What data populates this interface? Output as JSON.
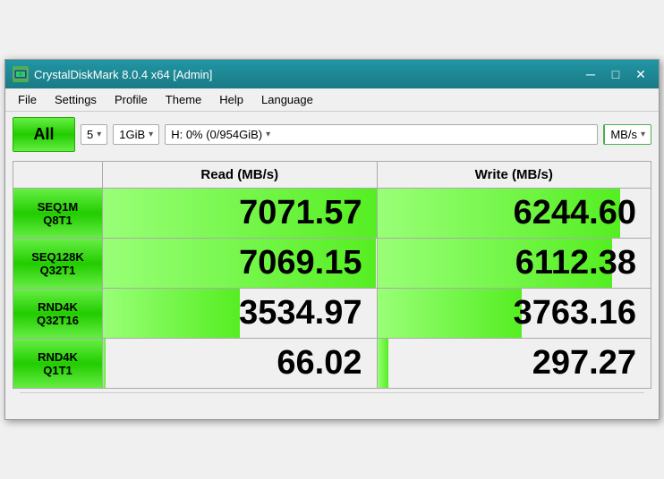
{
  "titlebar": {
    "title": "CrystalDiskMark 8.0.4 x64 [Admin]",
    "icon_label": "C",
    "minimize_label": "─",
    "maximize_label": "□",
    "close_label": "✕"
  },
  "menubar": {
    "items": [
      {
        "label": "File"
      },
      {
        "label": "Settings"
      },
      {
        "label": "Profile"
      },
      {
        "label": "Theme"
      },
      {
        "label": "Help"
      },
      {
        "label": "Language"
      }
    ]
  },
  "toolbar": {
    "all_button": "All",
    "runs_value": "5",
    "size_value": "1GiB",
    "drive_value": "H: 0% (0/954GiB)",
    "unit_value": "MB/s"
  },
  "table": {
    "col_read": "Read (MB/s)",
    "col_write": "Write (MB/s)",
    "rows": [
      {
        "label_line1": "SEQ1M",
        "label_line2": "Q8T1",
        "read": "7071.57",
        "write": "6244.60",
        "read_pct": 100,
        "write_pct": 89
      },
      {
        "label_line1": "SEQ128K",
        "label_line2": "Q32T1",
        "read": "7069.15",
        "write": "6112.38",
        "read_pct": 99.9,
        "write_pct": 86
      },
      {
        "label_line1": "RND4K",
        "label_line2": "Q32T16",
        "read": "3534.97",
        "write": "3763.16",
        "read_pct": 50,
        "write_pct": 53
      },
      {
        "label_line1": "RND4K",
        "label_line2": "Q1T1",
        "read": "66.02",
        "write": "297.27",
        "read_pct": 1,
        "write_pct": 4
      }
    ]
  }
}
